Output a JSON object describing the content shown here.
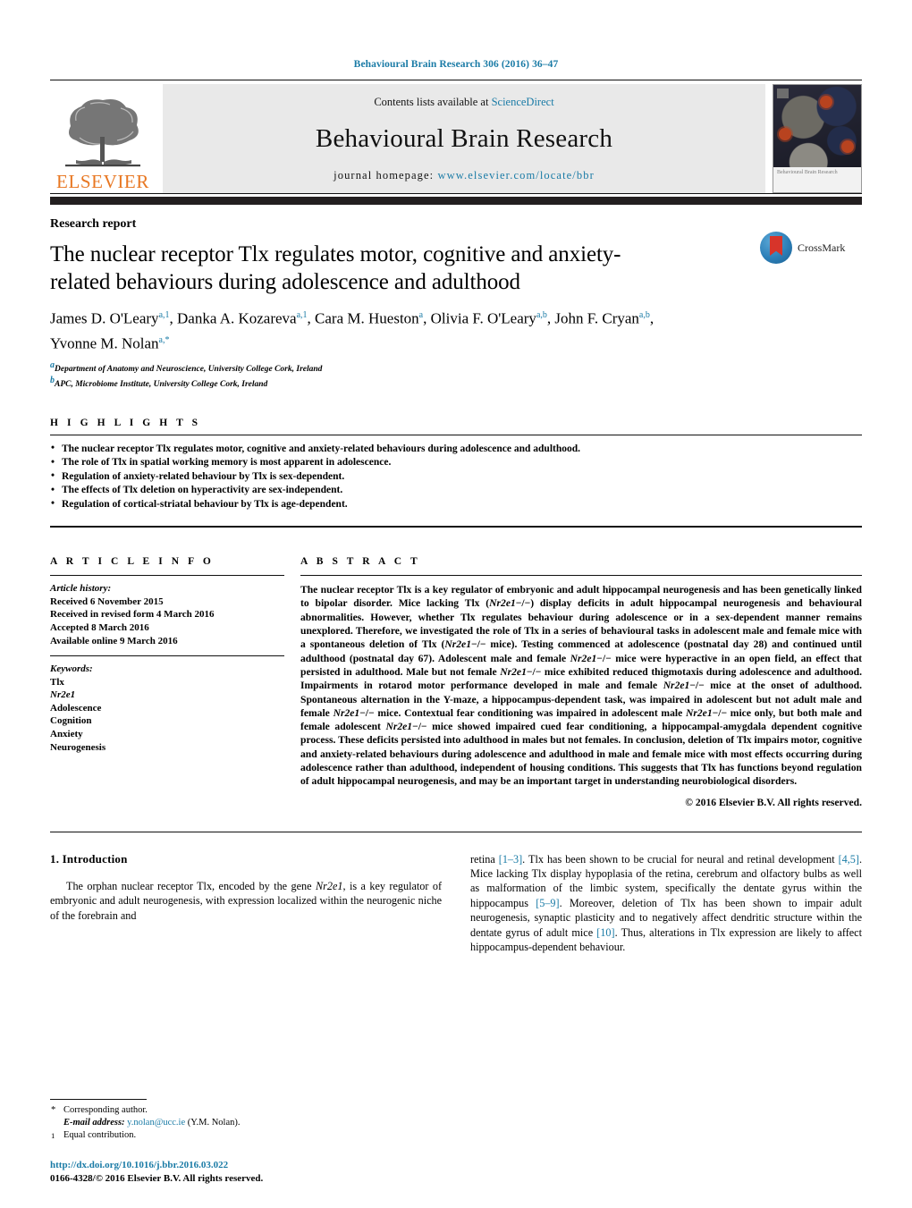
{
  "running_head": "Behavioural Brain Research 306 (2016) 36–47",
  "masthead": {
    "contents_prefix": "Contents lists available at ",
    "sciencedirect": "ScienceDirect",
    "journal_title": "Behavioural Brain Research",
    "homepage_label": "journal homepage:",
    "homepage_url": "www.elsevier.com/locate/bbr",
    "publisher": "ELSEVIER",
    "cover_caption": "Behavioural Brain Research",
    "accent_color": "#1a7ba6",
    "publisher_color": "#E87722"
  },
  "title_block": {
    "kicker": "Research report",
    "title": "The nuclear receptor Tlx regulates motor, cognitive and anxiety-related behaviours during adolescence and adulthood",
    "authors_line_1": "James D. O'Leary",
    "authors": [
      {
        "name": "James D. O'Leary",
        "sup": "a,1",
        "sep": ", "
      },
      {
        "name": "Danka A. Kozareva",
        "sup": "a,1",
        "sep": ", "
      },
      {
        "name": "Cara M. Hueston",
        "sup": "a",
        "sep": ", "
      },
      {
        "name": "Olivia F. O'Leary",
        "sup": "a,b",
        "sep": ", "
      },
      {
        "name": "John F. Cryan",
        "sup": "a,b",
        "sep": ", "
      },
      {
        "name": "Yvonne M. Nolan",
        "sup": "a,*",
        "sep": ""
      }
    ],
    "affiliations": [
      {
        "mark": "a",
        "text": "Department of Anatomy and Neuroscience, University College Cork, Ireland"
      },
      {
        "mark": "b",
        "text": "APC, Microbiome Institute, University College Cork, Ireland"
      }
    ],
    "crossmark_label": "CrossMark"
  },
  "highlights": {
    "heading": "H I G H L I G H T S",
    "items": [
      "The nuclear receptor Tlx regulates motor, cognitive and anxiety-related behaviours during adolescence and adulthood.",
      "The role of Tlx in spatial working memory is most apparent in adolescence.",
      "Regulation of anxiety-related behaviour by Tlx is sex-dependent.",
      "The effects of Tlx deletion on hyperactivity are sex-independent.",
      "Regulation of cortical-striatal behaviour by Tlx is age-dependent."
    ]
  },
  "article_info": {
    "heading": "A R T I C L E   I N F O",
    "history_label": "Article history:",
    "history": [
      "Received 6 November 2015",
      "Received in revised form 4 March 2016",
      "Accepted 8 March 2016",
      "Available online 9 March 2016"
    ],
    "keywords_label": "Keywords:",
    "keywords": [
      "Tlx",
      "Nr2e1",
      "Adolescence",
      "Cognition",
      "Anxiety",
      "Neurogenesis"
    ],
    "italic_keywords": [
      "Nr2e1"
    ]
  },
  "abstract": {
    "heading": "A B S T R A C T",
    "text": "The nuclear receptor Tlx is a key regulator of embryonic and adult hippocampal neurogenesis and has been genetically linked to bipolar disorder. Mice lacking Tlx (Nr2e1−/−) display deficits in adult hippocampal neurogenesis and behavioural abnormalities. However, whether Tlx regulates behaviour during adolescence or in a sex-dependent manner remains unexplored. Therefore, we investigated the role of Tlx in a series of behavioural tasks in adolescent male and female mice with a spontaneous deletion of Tlx (Nr2e1−/− mice). Testing commenced at adolescence (postnatal day 28) and continued until adulthood (postnatal day 67). Adolescent male and female Nr2e1−/− mice were hyperactive in an open field, an effect that persisted in adulthood. Male but not female Nr2e1−/− mice exhibited reduced thigmotaxis during adolescence and adulthood. Impairments in rotarod motor performance developed in male and female Nr2e1−/− mice at the onset of adulthood. Spontaneous alternation in the Y-maze, a hippocampus-dependent task, was impaired in adolescent but not adult male and female Nr2e1−/− mice. Contextual fear conditioning was impaired in adolescent male Nr2e1−/− mice only, but both male and female adolescent Nr2e1−/− mice showed impaired cued fear conditioning, a hippocampal-amygdala dependent cognitive process. These deficits persisted into adulthood in males but not females. In conclusion, deletion of Tlx impairs motor, cognitive and anxiety-related behaviours during adolescence and adulthood in male and female mice with most effects occurring during adolescence rather than adulthood, independent of housing conditions. This suggests that Tlx has functions beyond regulation of adult hippocampal neurogenesis, and may be an important target in understanding neurobiological disorders.",
    "copyright": "© 2016 Elsevier B.V. All rights reserved."
  },
  "introduction": {
    "heading": "1.  Introduction",
    "paragraph_left": "The orphan nuclear receptor Tlx, encoded by the gene Nr2e1, is a key regulator of embryonic and adult neurogenesis, with expression localized within the neurogenic niche of the forebrain and",
    "paragraph_right": "retina [1–3]. Tlx has been shown to be crucial for neural and retinal development [4,5]. Mice lacking Tlx display hypoplasia of the retina, cerebrum and olfactory bulbs as well as malformation of the limbic system, specifically the dentate gyrus within the hippocampus [5–9]. Moreover, deletion of Tlx has been shown to impair adult neurogenesis, synaptic plasticity and to negatively affect dendritic structure within the dentate gyrus of adult mice [10]. Thus, alterations in Tlx expression are likely to affect hippocampus-dependent behaviour.",
    "references_inline": [
      "[1–3]",
      "[4,5]",
      "[5–9]",
      "[10]"
    ]
  },
  "footnotes": {
    "corresponding": "Corresponding author.",
    "email_label": "E-mail address:",
    "email": "y.nolan@ucc.ie",
    "email_suffix": "(Y.M. Nolan).",
    "equal_contribution": "Equal contribution.",
    "doi": "http://dx.doi.org/10.1016/j.bbr.2016.03.022",
    "issn_line": "0166-4328/© 2016 Elsevier B.V. All rights reserved."
  }
}
